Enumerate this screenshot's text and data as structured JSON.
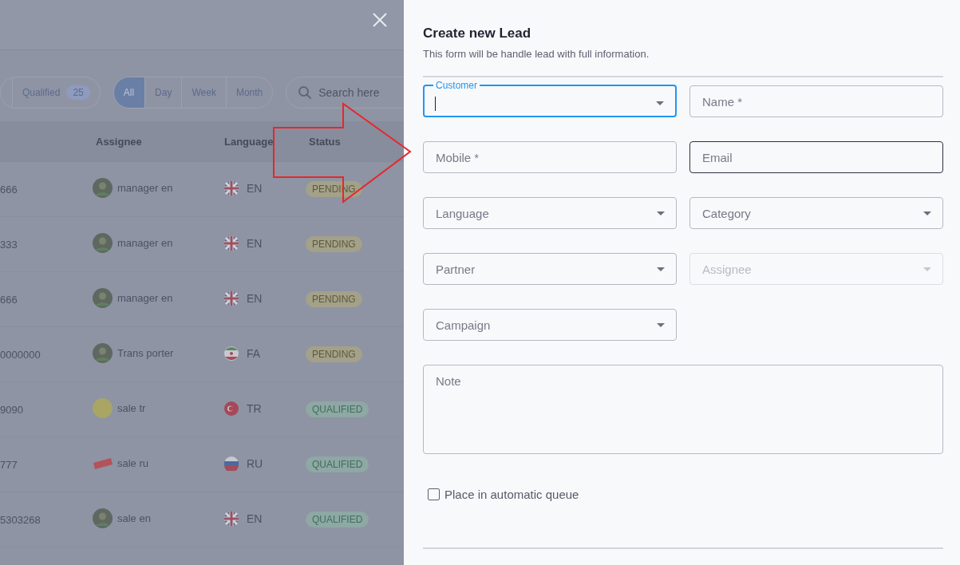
{
  "filters": {
    "status_segments": [
      {
        "label": "Qualified",
        "count": "25"
      }
    ],
    "periods": [
      {
        "label": "All",
        "selected": true
      },
      {
        "label": "Day",
        "selected": false
      },
      {
        "label": "Week",
        "selected": false
      },
      {
        "label": "Month",
        "selected": false
      }
    ],
    "search": {
      "placeholder": "Search here"
    }
  },
  "table": {
    "columns": [
      "Assignee",
      "Language",
      "Status"
    ],
    "rows": [
      {
        "column_1": "666",
        "assignee": {
          "name": "manager en",
          "kind": "photo"
        },
        "language": {
          "code": "EN",
          "kind": "uk"
        },
        "status": {
          "label": "PENDING",
          "kind": "pending"
        }
      },
      {
        "column_1": "333",
        "assignee": {
          "name": "manager en",
          "kind": "photo"
        },
        "language": {
          "code": "EN",
          "kind": "uk"
        },
        "status": {
          "label": "PENDING",
          "kind": "pending"
        }
      },
      {
        "column_1": "666",
        "assignee": {
          "name": "manager en",
          "kind": "photo"
        },
        "language": {
          "code": "EN",
          "kind": "uk"
        },
        "status": {
          "label": "PENDING",
          "kind": "pending"
        }
      },
      {
        "column_1": "0000000",
        "assignee": {
          "name": "Trans porter",
          "kind": "photo"
        },
        "language": {
          "code": "FA",
          "kind": "ir"
        },
        "status": {
          "label": "PENDING",
          "kind": "pending"
        }
      },
      {
        "column_1": "9090",
        "assignee": {
          "name": "sale tr",
          "kind": "js"
        },
        "language": {
          "code": "TR",
          "kind": "tr"
        },
        "status": {
          "label": "QUALIFIED",
          "kind": "qualified"
        }
      },
      {
        "column_1": "777",
        "assignee": {
          "name": "sale ru",
          "kind": "sale"
        },
        "language": {
          "code": "RU",
          "kind": "ru"
        },
        "status": {
          "label": "QUALIFIED",
          "kind": "qualified"
        }
      },
      {
        "column_1": "5303268",
        "assignee": {
          "name": "sale en",
          "kind": "photo"
        },
        "language": {
          "code": "EN",
          "kind": "uk"
        },
        "status": {
          "label": "QUALIFIED",
          "kind": "qualified"
        }
      }
    ]
  },
  "dialog": {
    "title": "Create new Lead",
    "subtitle": "This form will be handle lead with full information.",
    "fields": [
      {
        "kind": "select",
        "placeholder": "Customer",
        "focused": true,
        "hovered": false,
        "disabled": false
      },
      {
        "kind": "text",
        "placeholder": "Name *",
        "focused": false,
        "hovered": false,
        "disabled": false
      },
      {
        "kind": "text",
        "placeholder": "Mobile *",
        "focused": false,
        "hovered": false,
        "disabled": false
      },
      {
        "kind": "text",
        "placeholder": "Email",
        "focused": false,
        "hovered": true,
        "disabled": false
      },
      {
        "kind": "select",
        "placeholder": "Language",
        "focused": false,
        "hovered": false,
        "disabled": false
      },
      {
        "kind": "select",
        "placeholder": "Category",
        "focused": false,
        "hovered": false,
        "disabled": false
      },
      {
        "kind": "select",
        "placeholder": "Partner",
        "focused": false,
        "hovered": false,
        "disabled": false
      },
      {
        "kind": "select",
        "placeholder": "Assignee",
        "focused": false,
        "hovered": false,
        "disabled": true
      },
      {
        "kind": "select",
        "placeholder": "Campaign",
        "focused": false,
        "hovered": false,
        "disabled": false
      }
    ],
    "note": {
      "placeholder": "Note"
    },
    "queue_checkbox": {
      "label": "Place in automatic queue",
      "checked": false
    }
  }
}
